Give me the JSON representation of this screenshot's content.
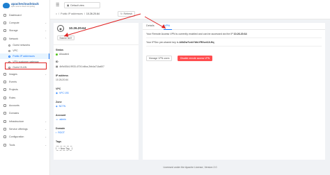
{
  "sidebar": {
    "logo_title": "apachecloudstack",
    "logo_sub": "open source cloud computing",
    "items": [
      {
        "label": "Dashboard",
        "caret": false
      },
      {
        "label": "Compute",
        "caret": true
      },
      {
        "label": "Storage",
        "caret": true
      },
      {
        "label": "Network",
        "caret": true
      }
    ],
    "network_sub": [
      {
        "label": "Guest networks",
        "active": false
      },
      {
        "label": "VPC",
        "active": false
      },
      {
        "label": "Public IP addresses",
        "active": true
      },
      {
        "label": "VPN customer gateway",
        "active": false
      },
      {
        "label": "Guest VLAN",
        "active": false
      }
    ],
    "items_after": [
      {
        "label": "Images",
        "caret": true
      },
      {
        "label": "Events",
        "caret": false
      },
      {
        "label": "Projects",
        "caret": false
      },
      {
        "label": "Roles",
        "caret": false
      },
      {
        "label": "Accounts",
        "caret": false
      },
      {
        "label": "Domains",
        "caret": false
      },
      {
        "label": "Infrastructure",
        "caret": true
      },
      {
        "label": "Service offerings",
        "caret": true
      },
      {
        "label": "Configuration",
        "caret": true
      },
      {
        "label": "Tools",
        "caret": true
      }
    ]
  },
  "header": {
    "project_select": "Default view",
    "breadcrumb": [
      "Home",
      "Public IP addresses",
      "10.26.20.64"
    ],
    "refresh_label": "Refresh"
  },
  "detail": {
    "ip_title": "10.26.20.64",
    "source_nat": "Source NAT",
    "fields": [
      {
        "label": "Status",
        "value": "Allocated",
        "type": "status"
      },
      {
        "label": "ID",
        "value": "4b9c5344-9933-4700-b4ba-2bb4a714a607",
        "type": "text"
      },
      {
        "label": "IP address",
        "value": "10.26.20.64",
        "type": "text"
      },
      {
        "label": "VPC",
        "value": "VPC 193",
        "type": "link"
      },
      {
        "label": "Zone",
        "value": "NCTN",
        "type": "link"
      },
      {
        "label": "Account",
        "value": "admin",
        "type": "link"
      },
      {
        "label": "Domain",
        "value": "ROOT",
        "type": "link"
      },
      {
        "label": "Tags",
        "value": "",
        "type": "none"
      }
    ],
    "new_tag": "+ New Tag"
  },
  "panel": {
    "tabs": [
      "Details",
      "VPN"
    ],
    "active_tab": "VPN",
    "vpn_msg_prefix": "Your Remote Access VPN is currently enabled and can be accessed via the IP",
    "vpn_ip": "10.26.20.64",
    "psk_prefix": "Your IPSec pre-shared key is",
    "psk": "A6kDw7vxkYbfuYR0vo6JLHq",
    "manage_btn": "Manage VPN users",
    "disable_btn": "Disable remote access VPN"
  },
  "footer": "Licensed under the Apache License, Version 2.0",
  "colors": {
    "accent": "#1677ff",
    "danger": "#ff4d4f",
    "annotation": "#e02020"
  }
}
